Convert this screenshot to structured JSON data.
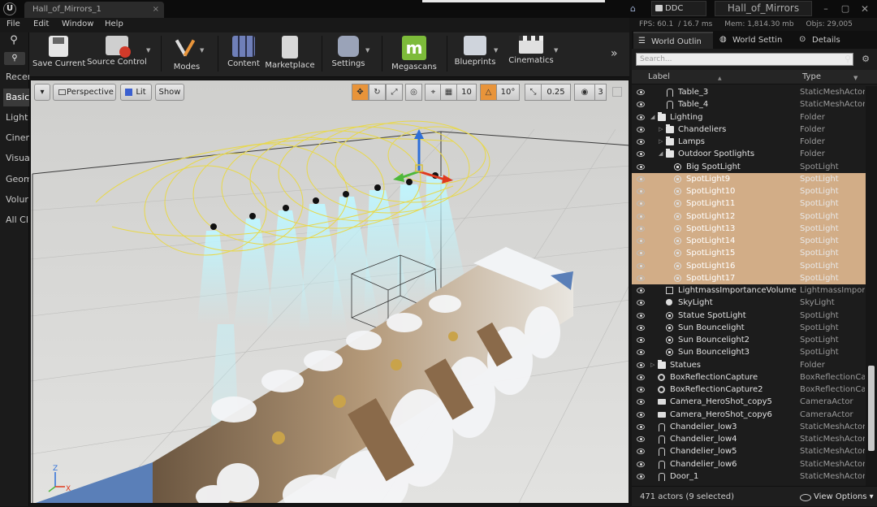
{
  "titlebar": {
    "tab_title": "Hall_of_Mirrors_1",
    "tab_close": "×",
    "ddc_label": "DDC",
    "project_name": "Hall_of_Mirrors",
    "minimize": "–",
    "maximize": "▢",
    "close": "✕"
  },
  "menu": {
    "items": [
      "File",
      "Edit",
      "Window",
      "Help"
    ]
  },
  "stats": {
    "fps": "FPS: 60.1",
    "ms": "/ 16.7 ms",
    "mem": "Mem: 1,814.30 mb",
    "objs": "Objs: 29,005"
  },
  "modes": {
    "tabs": [
      "Recen",
      "Basic",
      "Light",
      "Ciner",
      "Visua",
      "Geom",
      "Volur",
      "All Cl"
    ],
    "active": "Basic"
  },
  "toolbar": {
    "save": "Save Current",
    "source_control": "Source Control",
    "modes": "Modes",
    "content": "Content",
    "marketplace": "Marketplace",
    "settings": "Settings",
    "megascans": "Megascans",
    "blueprints": "Blueprints",
    "cinematics": "Cinematics",
    "expand": "»"
  },
  "viewport": {
    "dropdown": "▾",
    "perspective": "Perspective",
    "lit": "Lit",
    "show": "Show",
    "grid_snap": "10",
    "rot_snap": "10°",
    "scale_snap": "0.25",
    "cam_speed": "3",
    "axis_z": "Z",
    "axis_x": "X"
  },
  "outliner": {
    "tabs": [
      "World Outlin",
      "World Settin",
      "Details"
    ],
    "search_placeholder": "Search...",
    "header_label": "Label",
    "header_type": "Type",
    "rows": [
      {
        "label": "Table_3",
        "type": "StaticMeshActor",
        "icon": "mesh-icon",
        "indent": 2,
        "exp": "",
        "sel": false
      },
      {
        "label": "Table_4",
        "type": "StaticMeshActor",
        "icon": "mesh-icon",
        "indent": 2,
        "exp": "",
        "sel": false
      },
      {
        "label": "Lighting",
        "type": "Folder",
        "icon": "folder-icon",
        "indent": 1,
        "exp": "◢",
        "sel": false
      },
      {
        "label": "Chandeliers",
        "type": "Folder",
        "icon": "folder-icon",
        "indent": 2,
        "exp": "▷",
        "sel": false
      },
      {
        "label": "Lamps",
        "type": "Folder",
        "icon": "folder-icon",
        "indent": 2,
        "exp": "▷",
        "sel": false
      },
      {
        "label": "Outdoor Spotlights",
        "type": "Folder",
        "icon": "folder-icon",
        "indent": 2,
        "exp": "◢",
        "sel": false
      },
      {
        "label": "Big SpotLight",
        "type": "SpotLight",
        "icon": "spotlight-icon",
        "indent": 3,
        "exp": "",
        "sel": false
      },
      {
        "label": "SpotLight9",
        "type": "SpotLight",
        "icon": "spotlight-icon",
        "indent": 3,
        "exp": "",
        "sel": true
      },
      {
        "label": "SpotLight10",
        "type": "SpotLight",
        "icon": "spotlight-icon",
        "indent": 3,
        "exp": "",
        "sel": true
      },
      {
        "label": "SpotLight11",
        "type": "SpotLight",
        "icon": "spotlight-icon",
        "indent": 3,
        "exp": "",
        "sel": true
      },
      {
        "label": "SpotLight12",
        "type": "SpotLight",
        "icon": "spotlight-icon",
        "indent": 3,
        "exp": "",
        "sel": true
      },
      {
        "label": "SpotLight13",
        "type": "SpotLight",
        "icon": "spotlight-icon",
        "indent": 3,
        "exp": "",
        "sel": true
      },
      {
        "label": "SpotLight14",
        "type": "SpotLight",
        "icon": "spotlight-icon",
        "indent": 3,
        "exp": "",
        "sel": true
      },
      {
        "label": "SpotLight15",
        "type": "SpotLight",
        "icon": "spotlight-icon",
        "indent": 3,
        "exp": "",
        "sel": true
      },
      {
        "label": "SpotLight16",
        "type": "SpotLight",
        "icon": "spotlight-icon",
        "indent": 3,
        "exp": "",
        "sel": true
      },
      {
        "label": "SpotLight17",
        "type": "SpotLight",
        "icon": "spotlight-icon",
        "indent": 3,
        "exp": "",
        "sel": true
      },
      {
        "label": "LightmassImportanceVolume",
        "type": "LightmassImport",
        "icon": "volume-icon",
        "indent": 2,
        "exp": "",
        "sel": false
      },
      {
        "label": "SkyLight",
        "type": "SkyLight",
        "icon": "skylight-icon",
        "indent": 2,
        "exp": "",
        "sel": false
      },
      {
        "label": "Statue SpotLight",
        "type": "SpotLight",
        "icon": "spotlight-icon",
        "indent": 2,
        "exp": "",
        "sel": false
      },
      {
        "label": "Sun Bouncelight",
        "type": "SpotLight",
        "icon": "spotlight-icon",
        "indent": 2,
        "exp": "",
        "sel": false
      },
      {
        "label": "Sun Bouncelight2",
        "type": "SpotLight",
        "icon": "spotlight-icon",
        "indent": 2,
        "exp": "",
        "sel": false
      },
      {
        "label": "Sun Bouncelight3",
        "type": "SpotLight",
        "icon": "spotlight-icon",
        "indent": 2,
        "exp": "",
        "sel": false
      },
      {
        "label": "Statues",
        "type": "Folder",
        "icon": "folder-icon",
        "indent": 1,
        "exp": "▷",
        "sel": false
      },
      {
        "label": "BoxReflectionCapture",
        "type": "BoxReflectionCap",
        "icon": "capture-icon",
        "indent": 1,
        "exp": "",
        "sel": false
      },
      {
        "label": "BoxReflectionCapture2",
        "type": "BoxReflectionCap",
        "icon": "capture-icon",
        "indent": 1,
        "exp": "",
        "sel": false
      },
      {
        "label": "Camera_HeroShot_copy5",
        "type": "CameraActor",
        "icon": "camera-icon",
        "indent": 1,
        "exp": "",
        "sel": false
      },
      {
        "label": "Camera_HeroShot_copy6",
        "type": "CameraActor",
        "icon": "camera-icon",
        "indent": 1,
        "exp": "",
        "sel": false
      },
      {
        "label": "Chandelier_low3",
        "type": "StaticMeshActor",
        "icon": "mesh-icon",
        "indent": 1,
        "exp": "",
        "sel": false
      },
      {
        "label": "Chandelier_low4",
        "type": "StaticMeshActor",
        "icon": "mesh-icon",
        "indent": 1,
        "exp": "",
        "sel": false
      },
      {
        "label": "Chandelier_low5",
        "type": "StaticMeshActor",
        "icon": "mesh-icon",
        "indent": 1,
        "exp": "",
        "sel": false
      },
      {
        "label": "Chandelier_low6",
        "type": "StaticMeshActor",
        "icon": "mesh-icon",
        "indent": 1,
        "exp": "",
        "sel": false
      },
      {
        "label": "Door_1",
        "type": "StaticMeshActor",
        "icon": "mesh-icon",
        "indent": 1,
        "exp": "",
        "sel": false
      }
    ],
    "footer_count": "471 actors (9 selected)",
    "view_options": "View Options ▾"
  },
  "colors": {
    "selection": "#d2ad87",
    "spotlight_cone": "#e8d84a",
    "light_shaft": "#a8f0f8",
    "gizmo_x": "#e03a1e",
    "gizmo_y": "#4db83a",
    "gizmo_z": "#2e6fd8"
  }
}
